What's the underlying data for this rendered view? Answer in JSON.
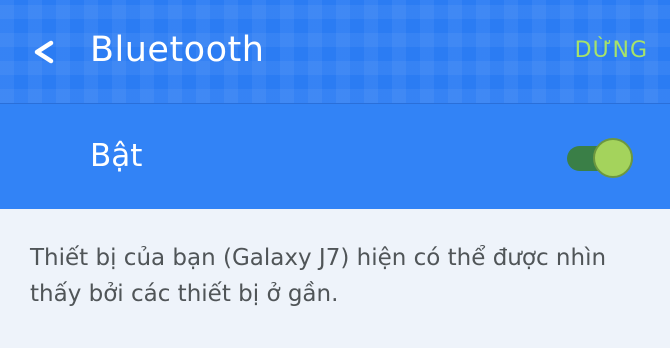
{
  "appbar": {
    "title": "Bluetooth",
    "back_icon": "chevron-left-icon",
    "action_label": "DỪNG",
    "action_color": "#a6e36a",
    "background_color": "#2b7cf3"
  },
  "bluetooth_toggle": {
    "label": "Bật",
    "state": "on",
    "track_color": "#3a7f47",
    "thumb_color": "#a4d35c"
  },
  "visibility_description": "Thiết bị của bạn (Galaxy J7) hiện có thể được nhìn thấy bởi các thiết bị ở gần."
}
